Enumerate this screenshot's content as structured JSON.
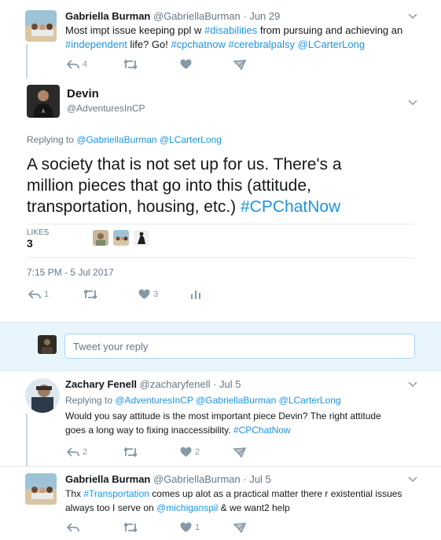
{
  "tweet1": {
    "name": "Gabriella Burman",
    "handle": "@GabriellaBurman",
    "date": "· Jun 29",
    "t1": "Most impt issue keeping ppl w ",
    "h1": "#disabilities",
    "t2": " from pursuing and achieving an",
    "h2": "#independent",
    "t3": " life? Go! ",
    "h3": "#cpchatnow",
    "h4": "#cerebralpalsy",
    "h5": "@LCarterLong",
    "replies": "4"
  },
  "main": {
    "name": "Devin",
    "handle": "@AdventuresInCP",
    "replying_prefix": "Replying to ",
    "replying_1": "@GabriellaBurman",
    "replying_2": "@LCarterLong",
    "text_line1": "A society that is not set up for us. There's a",
    "text_line2": "million pieces that go into this (attitude,",
    "text_line3": "transportation, housing, etc.) ",
    "hashtag": "#CPChatNow",
    "likes_label": "LIKES",
    "likes_count": "3",
    "timestamp": "7:15 PM - 5 Jul 2017",
    "replies": "1",
    "likes": "3"
  },
  "compose": {
    "placeholder": "Tweet your reply"
  },
  "reply1": {
    "name": "Zachary Fenell",
    "handle": "@zacharyfenell",
    "date": "· Jul 5",
    "replying_prefix": "Replying to ",
    "replying_1": "@AdventuresInCP",
    "replying_2": "@GabriellaBurman",
    "replying_3": "@LCarterLong",
    "line1": "Would you say attitude is the most important piece Devin? The right attitude",
    "line2": "goes a long way to fixing inaccessibility. ",
    "hashtag": "#CPChatNow",
    "replies": "2",
    "likes": "2"
  },
  "reply2": {
    "name": "Gabriella Burman",
    "handle": "@GabriellaBurman",
    "date": "· Jul 5",
    "t1": "Thx ",
    "h1": "#Transportation",
    "t2": " comes up alot as a practical matter there r existential issues",
    "t3": "always too I serve on ",
    "m1": "@michiganspil",
    "t4": " & we want2 help",
    "likes": "1"
  },
  "colors": {
    "link": "#1b95e0",
    "muted": "#657786",
    "icon": "#8899a6",
    "compose_bg": "#e8f5fd"
  }
}
